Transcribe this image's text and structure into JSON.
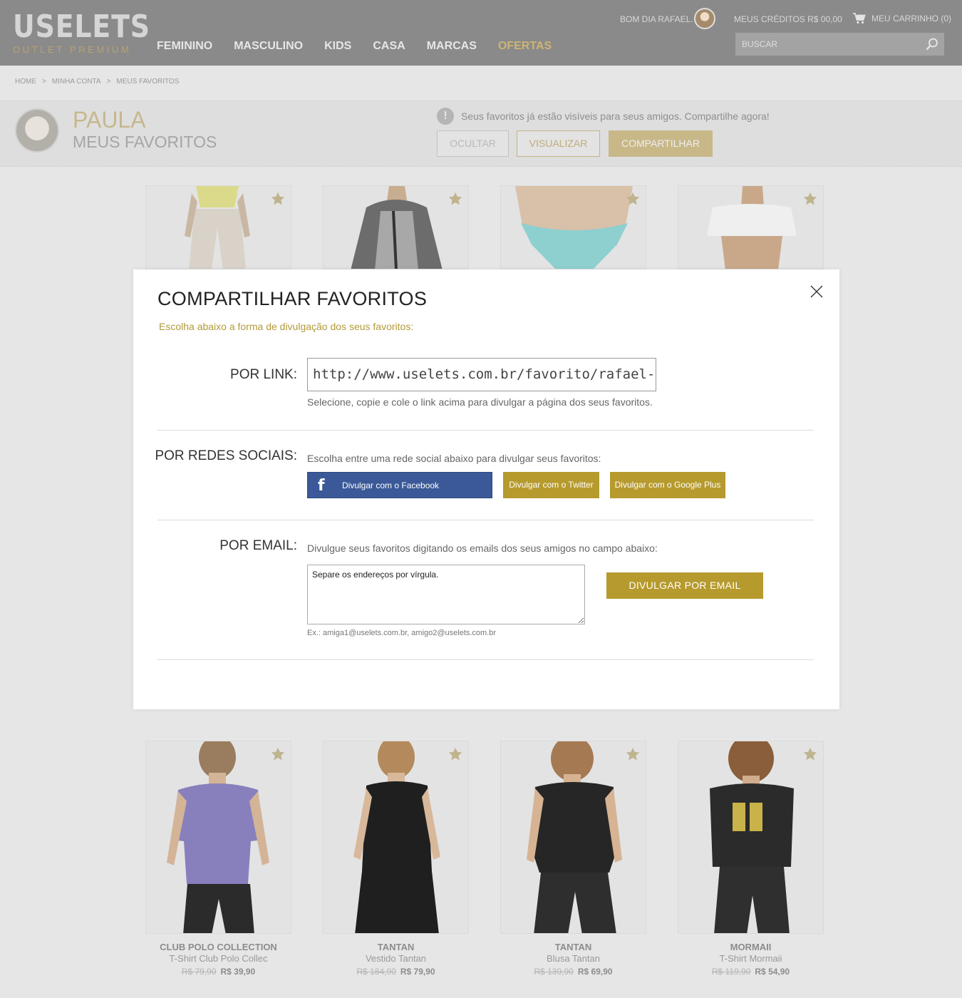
{
  "header": {
    "logo_main": "USELETS",
    "logo_sub": "OUTLET PREMIUM",
    "nav": [
      "FEMININO",
      "MASCULINO",
      "KIDS",
      "CASA",
      "MARCAS",
      "OFERTAS"
    ],
    "greeting": "BOM DIA RAFAEL.",
    "credits": "MEUS CRÉDITOS R$ 00,00",
    "cart": "MEU CARRINHO (0)",
    "search_placeholder": "BUSCAR"
  },
  "breadcrumb": [
    "HOME",
    ">",
    "MINHA CONTA",
    ">",
    "MEUS FAVORITOS"
  ],
  "profile": {
    "name": "PAULA",
    "subtitle": "MEUS FAVORITOS",
    "notice": "Seus favoritos já estão visíveis para seus amigos. Compartilhe agora!",
    "notice_icon": "!",
    "buttons": {
      "hide": "OCULTAR",
      "view": "VISUALIZAR",
      "share": "COMPARTILHAR"
    }
  },
  "products_bottom": [
    {
      "brand": "CLUB POLO COLLECTION",
      "name": "T-Shirt Club Polo Collec",
      "old_price": "R$ 79,90",
      "price": "R$ 39,90",
      "shirt_color": "#7d74b6"
    },
    {
      "brand": "TANTAN",
      "name": "Vestido Tantan",
      "old_price": "R$ 184,90",
      "price": "R$ 79,90",
      "shirt_color": "#1d1d1d"
    },
    {
      "brand": "TANTAN",
      "name": "Blusa Tantan",
      "old_price": "R$ 139,90",
      "price": "R$ 69,90",
      "shirt_color": "#222222"
    },
    {
      "brand": "MORMAII",
      "name": "T-Shirt Mormaii",
      "old_price": "R$ 119,90",
      "price": "R$ 54,90",
      "shirt_color": "#2a2a2a"
    }
  ],
  "modal": {
    "title": "COMPARTILHAR FAVORITOS",
    "subtitle": "Escolha abaixo a forma de divulgação dos seus favoritos:",
    "link": {
      "label": "POR LINK:",
      "value": "http://www.uselets.com.br/favorito/rafael-du",
      "hint": "Selecione, copie e cole o link acima para divulgar a página dos seus favoritos."
    },
    "social": {
      "label": "POR REDES SOCIAIS:",
      "hint": "Escolha entre uma rede social abaixo para divulgar seus favoritos:",
      "facebook_icon": "f",
      "facebook": "Divulgar com o Facebook",
      "twitter": "Divulgar com o Twitter",
      "googleplus": "Divulgar com o Google Plus"
    },
    "email": {
      "label": "POR EMAIL:",
      "hint": "Divulgue seus favoritos digitando os emails dos seus amigos no campo abaixo:",
      "placeholder": "Separe os endereços por vírgula.",
      "example": "Ex.: amiga1@uselets.com.br, amigo2@uselets.com.br",
      "button": "DIVULGAR POR EMAIL"
    }
  },
  "colors": {
    "gold": "#b69a2d",
    "facebook": "#3b5998",
    "header": "#8a8a8a",
    "accent_soft": "#c8b888"
  }
}
